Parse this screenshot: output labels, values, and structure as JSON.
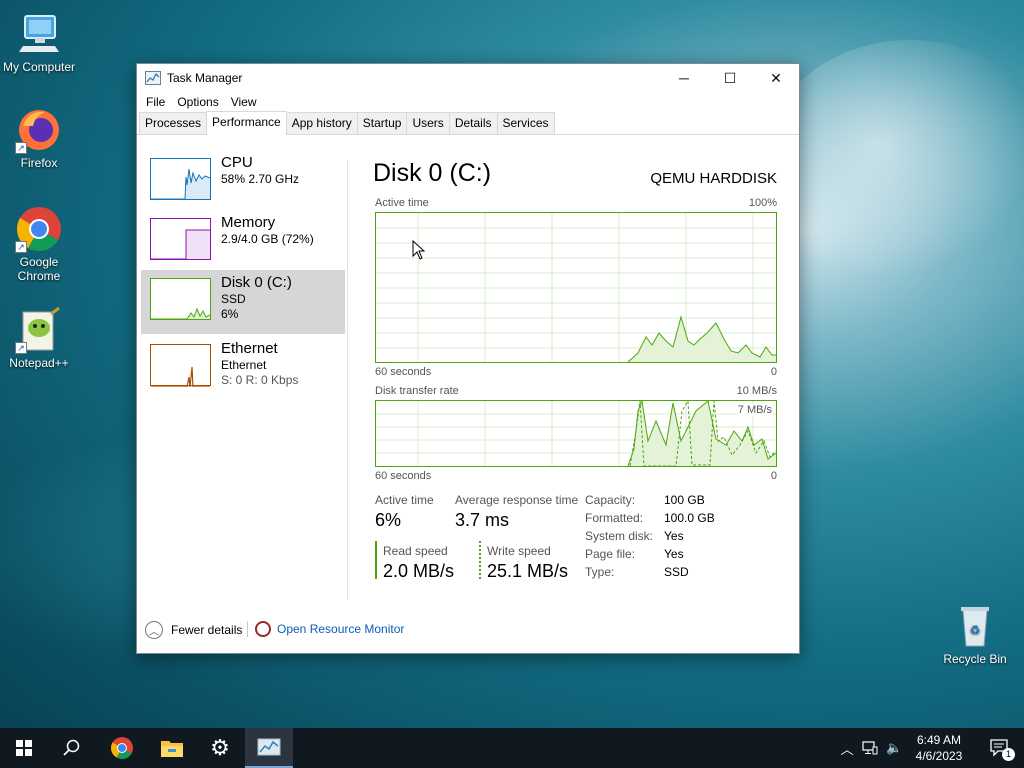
{
  "desktop": {
    "icons": [
      {
        "label": "My Computer"
      },
      {
        "label": "Firefox"
      },
      {
        "label": "Google Chrome"
      },
      {
        "label": "Notepad++"
      },
      {
        "label": "Recycle Bin"
      }
    ]
  },
  "window": {
    "title": "Task Manager",
    "controls": {
      "minimize": "─",
      "maximize": "☐",
      "close": "✕"
    },
    "menu": [
      "File",
      "Options",
      "View"
    ],
    "tabs": [
      "Processes",
      "Performance",
      "App history",
      "Startup",
      "Users",
      "Details",
      "Services"
    ],
    "active_tab": "Performance"
  },
  "sidebar": {
    "items": [
      {
        "name": "CPU",
        "line1": "58%  2.70 GHz",
        "line2": ""
      },
      {
        "name": "Memory",
        "line1": "2.9/4.0 GB (72%)",
        "line2": ""
      },
      {
        "name": "Disk 0 (C:)",
        "line1": "SSD",
        "line2": "6%"
      },
      {
        "name": "Ethernet",
        "line1": "Ethernet",
        "line2": "S: 0  R: 0 Kbps"
      }
    ]
  },
  "detail": {
    "title": "Disk 0 (C:)",
    "model": "QEMU HARDDISK",
    "active_graph": {
      "label": "Active time",
      "max_label": "100%",
      "time_label": "60 seconds",
      "min_label": "0"
    },
    "transfer_graph": {
      "label": "Disk transfer rate",
      "max_label": "10 MB/s",
      "inner_label": "7 MB/s",
      "time_label": "60 seconds",
      "min_label": "0"
    },
    "stats": {
      "active_time_label": "Active time",
      "active_time_value": "6%",
      "avg_response_label": "Average response time",
      "avg_response_value": "3.7 ms",
      "read_label": "Read speed",
      "read_value": "2.0 MB/s",
      "write_label": "Write speed",
      "write_value": "25.1 MB/s"
    },
    "properties": [
      {
        "label": "Capacity:",
        "value": "100 GB"
      },
      {
        "label": "Formatted:",
        "value": "100.0 GB"
      },
      {
        "label": "System disk:",
        "value": "Yes"
      },
      {
        "label": "Page file:",
        "value": "Yes"
      },
      {
        "label": "Type:",
        "value": "SSD"
      }
    ]
  },
  "footer": {
    "fewer_details": "Fewer details",
    "open_resource_monitor": "Open Resource Monitor"
  },
  "taskbar": {
    "time": "6:49 AM",
    "date": "4/6/2023",
    "notification_count": "1"
  },
  "colors": {
    "disk_green": "#4da60c",
    "cpu_blue": "#1174c0",
    "memory_purple": "#8b12ae",
    "ethernet_orange": "#a74f01",
    "link_blue": "#0a5fb4"
  }
}
